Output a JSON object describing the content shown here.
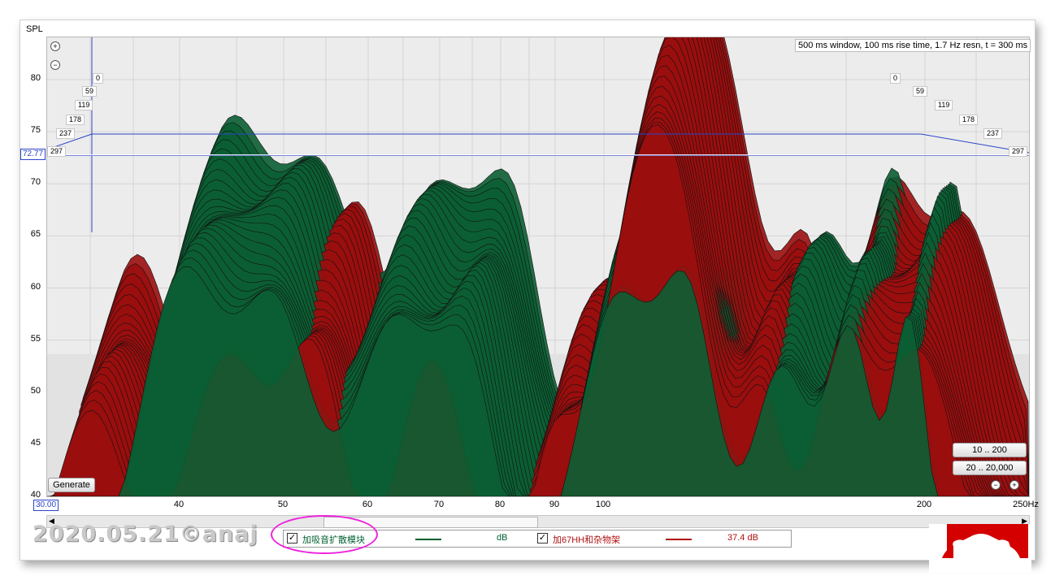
{
  "chart_data": {
    "type": "area",
    "title": "",
    "ylabel": "SPL",
    "y_ticks": [
      "80",
      "75",
      "70",
      "65",
      "60",
      "55",
      "50",
      "45",
      "40"
    ],
    "x_ticks": [
      "40",
      "50",
      "60",
      "70",
      "80",
      "90",
      "100",
      "200",
      "250Hz"
    ],
    "ylim": [
      40,
      80
    ],
    "x_range_start": "30.00",
    "cursor_value": "72.77",
    "time_labels_left": [
      "0",
      "59",
      "119",
      "178",
      "237",
      "297"
    ],
    "time_labels_right": [
      "0",
      "59",
      "119",
      "178",
      "237",
      "297"
    ],
    "info": "500 ms window, 100 ms rise time,  1.7 Hz resn, t = 300 ms",
    "series": [
      {
        "name": "加吸音扩散模块",
        "color": "#006030"
      },
      {
        "name": "加67HH和杂物架",
        "color": "#b01010"
      }
    ]
  },
  "controls": {
    "generate": "Generate",
    "range_low": "10 .. 200",
    "range_full": "20 .. 20,000"
  },
  "legend": {
    "item1_label": "加吸音扩散模块",
    "item1_value": "dB",
    "item1_color": "#006030",
    "item2_label": "加67HH和杂物架",
    "item2_value": "37.4 dB",
    "item2_color": "#b01010"
  },
  "watermark": "2020.05.21©anaj",
  "icons": [
    "zoom-in-icon",
    "zoom-out-icon",
    "zoom-minus-icon",
    "zoom-plus-icon"
  ]
}
